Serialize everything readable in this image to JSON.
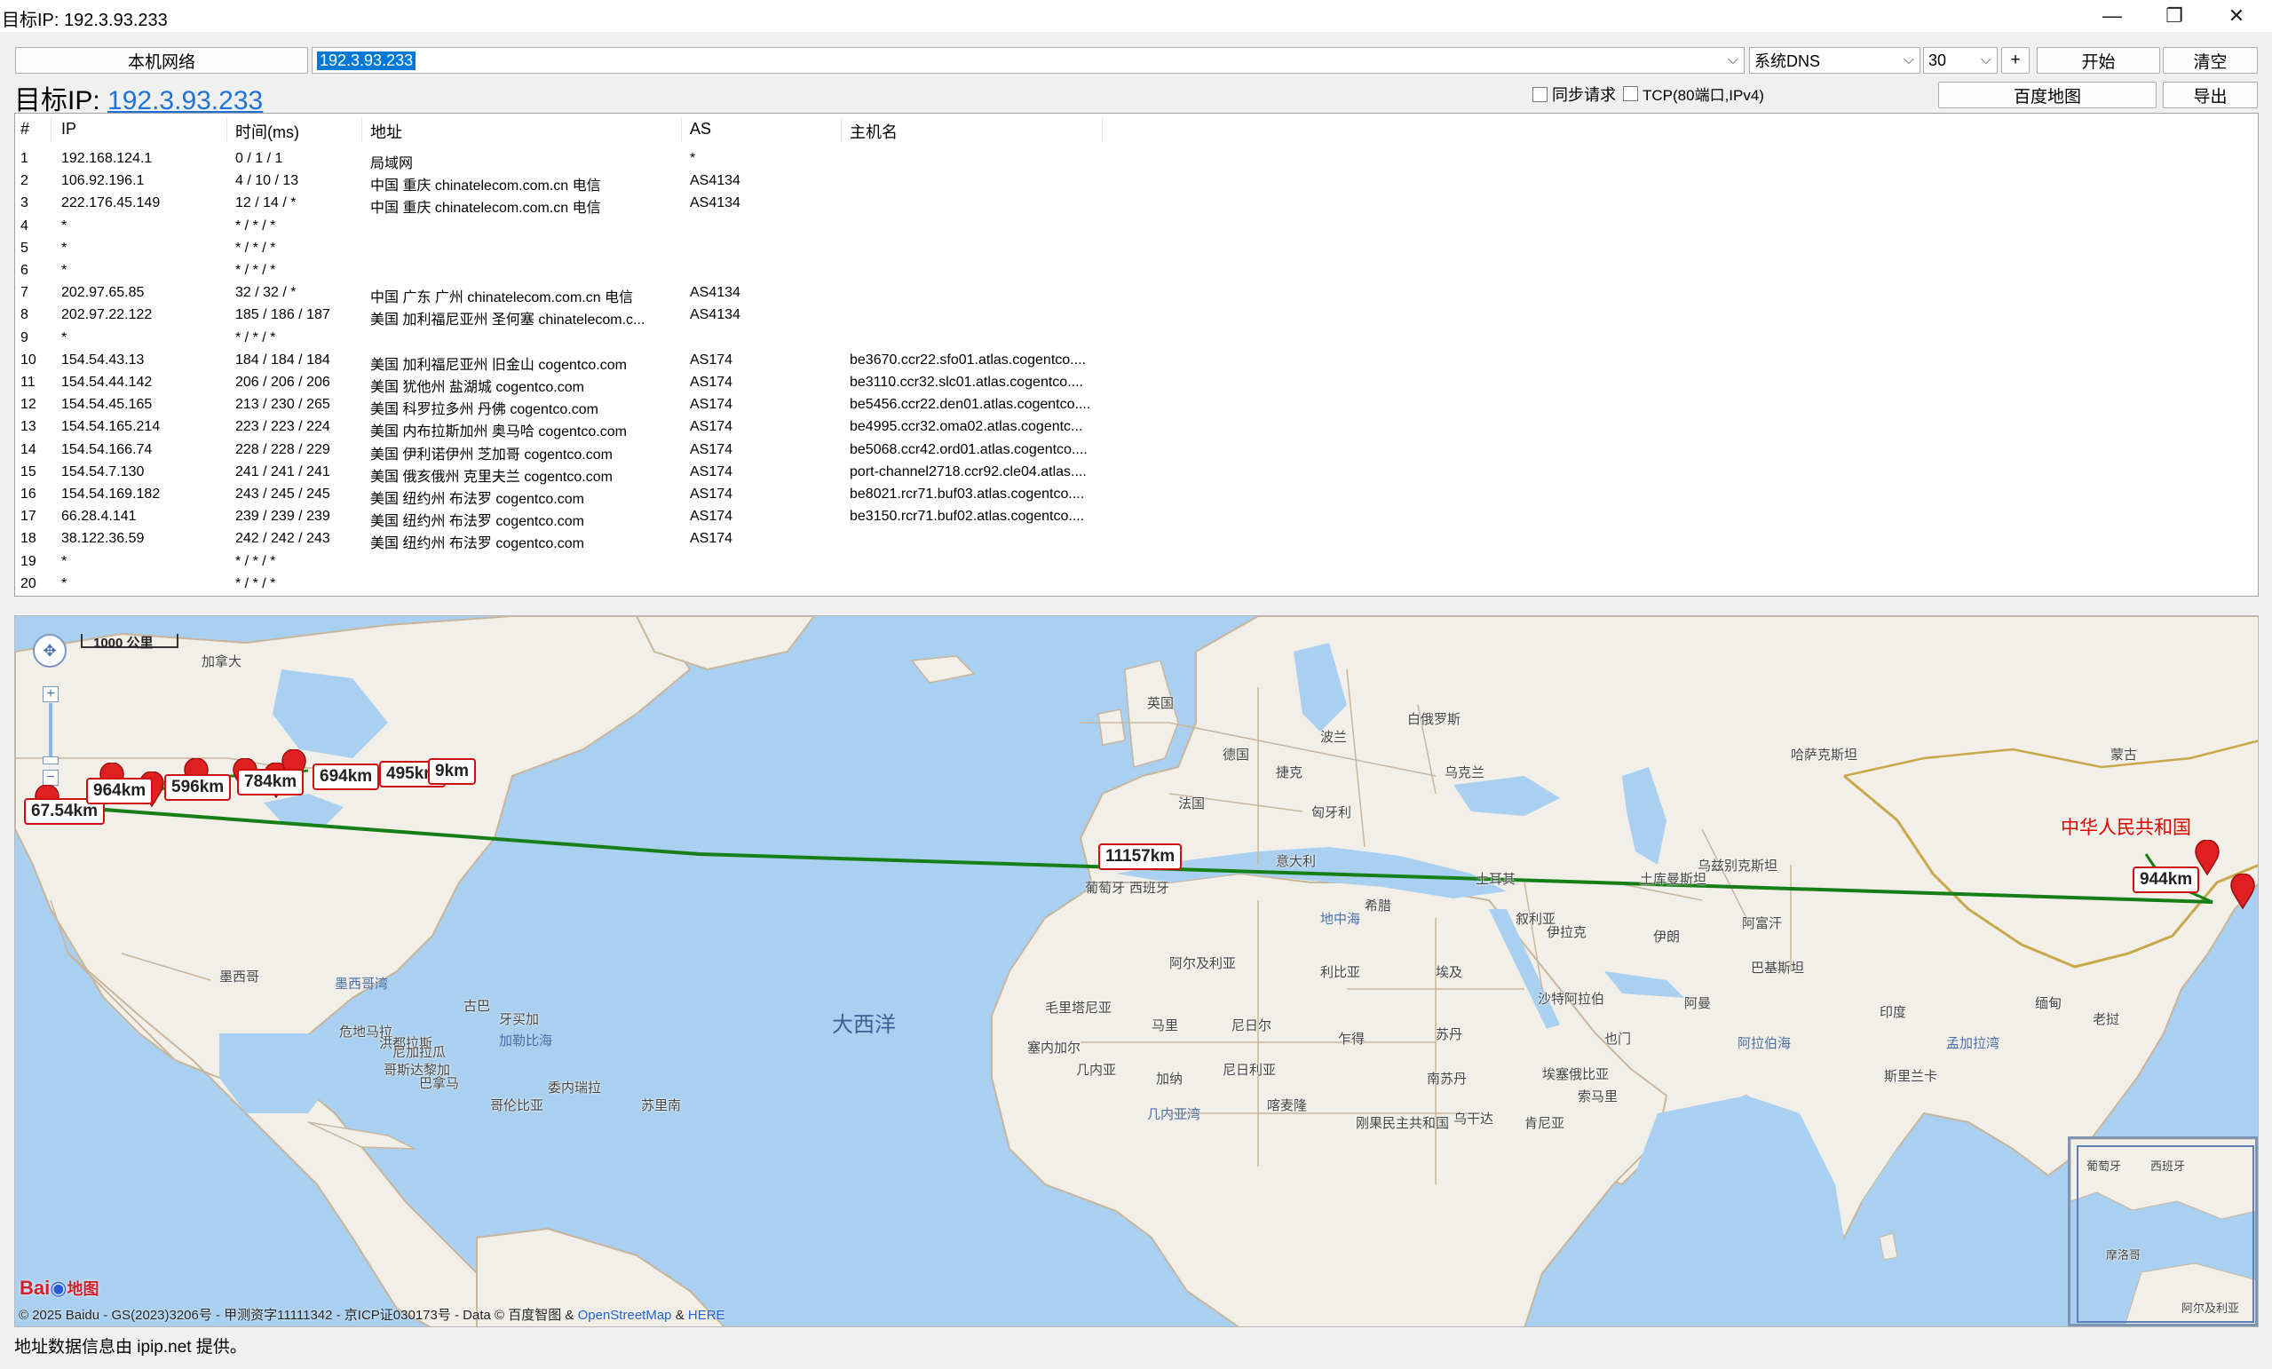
{
  "window": {
    "title": "目标IP: 192.3.93.233"
  },
  "toolbar": {
    "local_network": "本机网络",
    "ip_value": "192.3.93.233",
    "dns": "系统DNS",
    "max_hops": "30",
    "plus": "+",
    "start": "开始",
    "clear": "清空",
    "baidu_map": "百度地图",
    "export": "导出"
  },
  "target": {
    "label": "目标IP:",
    "ip": "192.3.93.233"
  },
  "options": {
    "sync_request": "同步请求",
    "tcp": "TCP(80端口,IPv4)"
  },
  "table": {
    "headers": [
      "#",
      "IP",
      "时间(ms)",
      "地址",
      "AS",
      "主机名"
    ],
    "rows": [
      [
        "1",
        "192.168.124.1",
        "0 / 1 / 1",
        "局域网",
        "*",
        ""
      ],
      [
        "2",
        "106.92.196.1",
        "4 / 10 / 13",
        "中国 重庆 chinatelecom.com.cn 电信",
        "AS4134",
        ""
      ],
      [
        "3",
        "222.176.45.149",
        "12 / 14 / *",
        "中国 重庆 chinatelecom.com.cn 电信",
        "AS4134",
        ""
      ],
      [
        "4",
        "*",
        "* / * / *",
        "",
        "",
        ""
      ],
      [
        "5",
        "*",
        "* / * / *",
        "",
        "",
        ""
      ],
      [
        "6",
        "*",
        "* / * / *",
        "",
        "",
        ""
      ],
      [
        "7",
        "202.97.65.85",
        "32 / 32 / *",
        "中国 广东 广州 chinatelecom.com.cn 电信",
        "AS4134",
        ""
      ],
      [
        "8",
        "202.97.22.122",
        "185 / 186 / 187",
        "美国 加利福尼亚州 圣何塞 chinatelecom.c...",
        "AS4134",
        ""
      ],
      [
        "9",
        "*",
        "* / * / *",
        "",
        "",
        ""
      ],
      [
        "10",
        "154.54.43.13",
        "184 / 184 / 184",
        "美国 加利福尼亚州 旧金山 cogentco.com",
        "AS174",
        "be3670.ccr22.sfo01.atlas.cogentco...."
      ],
      [
        "11",
        "154.54.44.142",
        "206 / 206 / 206",
        "美国 犹他州 盐湖城 cogentco.com",
        "AS174",
        "be3110.ccr32.slc01.atlas.cogentco...."
      ],
      [
        "12",
        "154.54.45.165",
        "213 / 230 / 265",
        "美国 科罗拉多州 丹佛 cogentco.com",
        "AS174",
        "be5456.ccr22.den01.atlas.cogentco...."
      ],
      [
        "13",
        "154.54.165.214",
        "223 / 223 / 224",
        "美国 内布拉斯加州 奥马哈 cogentco.com",
        "AS174",
        "be4995.ccr32.oma02.atlas.cogentc..."
      ],
      [
        "14",
        "154.54.166.74",
        "228 / 228 / 229",
        "美国 伊利诺伊州 芝加哥 cogentco.com",
        "AS174",
        "be5068.ccr42.ord01.atlas.cogentco...."
      ],
      [
        "15",
        "154.54.7.130",
        "241 / 241 / 241",
        "美国 俄亥俄州 克里夫兰 cogentco.com",
        "AS174",
        "port-channel2718.ccr92.cle04.atlas...."
      ],
      [
        "16",
        "154.54.169.182",
        "243 / 245 / 245",
        "美国 纽约州 布法罗 cogentco.com",
        "AS174",
        "be8021.rcr71.buf03.atlas.cogentco...."
      ],
      [
        "17",
        "66.28.4.141",
        "239 / 239 / 239",
        "美国 纽约州 布法罗 cogentco.com",
        "AS174",
        "be3150.rcr71.buf02.atlas.cogentco...."
      ],
      [
        "18",
        "38.122.36.59",
        "242 / 242 / 243",
        "美国 纽约州 布法罗 cogentco.com",
        "AS174",
        ""
      ],
      [
        "19",
        "*",
        "* / * / *",
        "",
        "",
        ""
      ],
      [
        "20",
        "*",
        "* / * / *",
        "",
        "",
        ""
      ]
    ]
  },
  "map": {
    "scale": "1000 公里",
    "distances": [
      "67.54km",
      "964km",
      "596km",
      "784km",
      "694km",
      "495km",
      "9km",
      "11157km",
      "944km"
    ],
    "countries": {
      "canada": "加拿大",
      "uk": "英国",
      "france": "法国",
      "germany": "德国",
      "poland": "波兰",
      "belarus": "白俄罗斯",
      "czech": "捷克",
      "ukraine": "乌克兰",
      "hungary": "匈牙利",
      "kazakhstan": "哈萨克斯坦",
      "mongolia": "蒙古",
      "italy": "意大利",
      "portugal": "葡萄牙",
      "spain": "西班牙",
      "turkey": "土耳其",
      "greece": "希腊",
      "turkmenistan": "土库曼斯坦",
      "uzbekistan": "乌兹别克斯坦",
      "mediterranean": "地中海",
      "syria": "叙利亚",
      "iraq": "伊拉克",
      "afghanistan": "阿富汗",
      "iran": "伊朗",
      "pakistan": "巴基斯坦",
      "china": "中华人民共和国",
      "algeria": "阿尔及利亚",
      "libya": "利比亚",
      "egypt": "埃及",
      "saudi": "沙特阿拉伯",
      "india": "印度",
      "myanmar": "缅甸",
      "laos": "老挝",
      "mexico": "墨西哥",
      "gulf_mexico": "墨西哥湾",
      "cuba": "古巴",
      "atlantic": "大西洋",
      "mauritania": "毛里塔尼亚",
      "mali": "马里",
      "niger": "尼日尔",
      "chad": "乍得",
      "sudan": "苏丹",
      "oman": "阿曼",
      "yemen": "也门",
      "jamaica": "牙买加",
      "guatemala": "危地马拉",
      "honduras": "洪都拉斯",
      "nicaragua": "尼加拉瓜",
      "caribbean": "加勒比海",
      "costa_rica": "哥斯达黎加",
      "panama": "巴拿马",
      "venezuela": "委内瑞拉",
      "colombia": "哥伦比亚",
      "suriname": "苏里南",
      "senegal": "塞内加尔",
      "guinea": "几内亚",
      "ghana": "加纳",
      "nigeria": "尼日利亚",
      "cameroon": "喀麦隆",
      "ethiopia": "埃塞俄比亚",
      "south_sudan": "南苏丹",
      "somalia": "索马里",
      "arabian_sea": "阿拉伯海",
      "sri_lanka": "斯里兰卡",
      "bay_bengal": "孟加拉湾",
      "gulf_guinea": "几内亚湾",
      "drc": "刚果民主共和国",
      "uganda": "乌干达",
      "kenya": "肯尼亚",
      "morocco": "摩洛哥",
      "algeria_short": "阿尔及利亚"
    },
    "copyright_text": "© 2025 Baidu - GS(2023)3206号 - 甲测资字11111342 - 京ICP证030173号 - Data © 百度智图 &",
    "osm": "OpenStreetMap",
    "amp": "&",
    "here": "HERE",
    "logo": "地图"
  },
  "status": "地址数据信息由 ipip.net 提供。"
}
